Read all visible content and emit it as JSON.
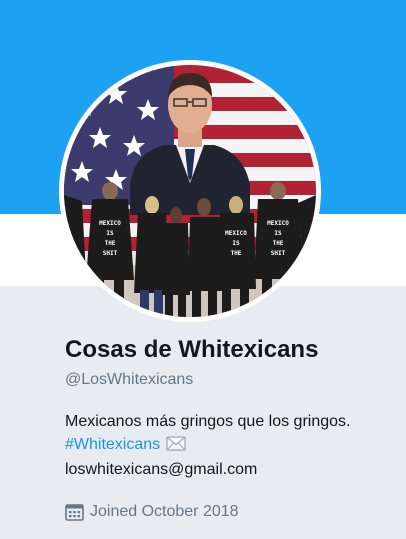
{
  "profile": {
    "display_name": "Cosas de Whitexicans",
    "handle": "@LosWhitexicans",
    "bio": {
      "line1": "Mexicanos más gringos que los gringos.",
      "hashtag": "#Whitexicans",
      "email": "loswhitexicans@gmail.com"
    },
    "joined": "Joined October 2018"
  },
  "icons": {
    "envelope": "envelope-icon",
    "calendar": "calendar-icon"
  },
  "colors": {
    "banner": "#1da1f2",
    "page_background": "#e6ecf0",
    "text_primary": "#14171a",
    "text_secondary": "#657786",
    "link": "#1b95e0"
  }
}
